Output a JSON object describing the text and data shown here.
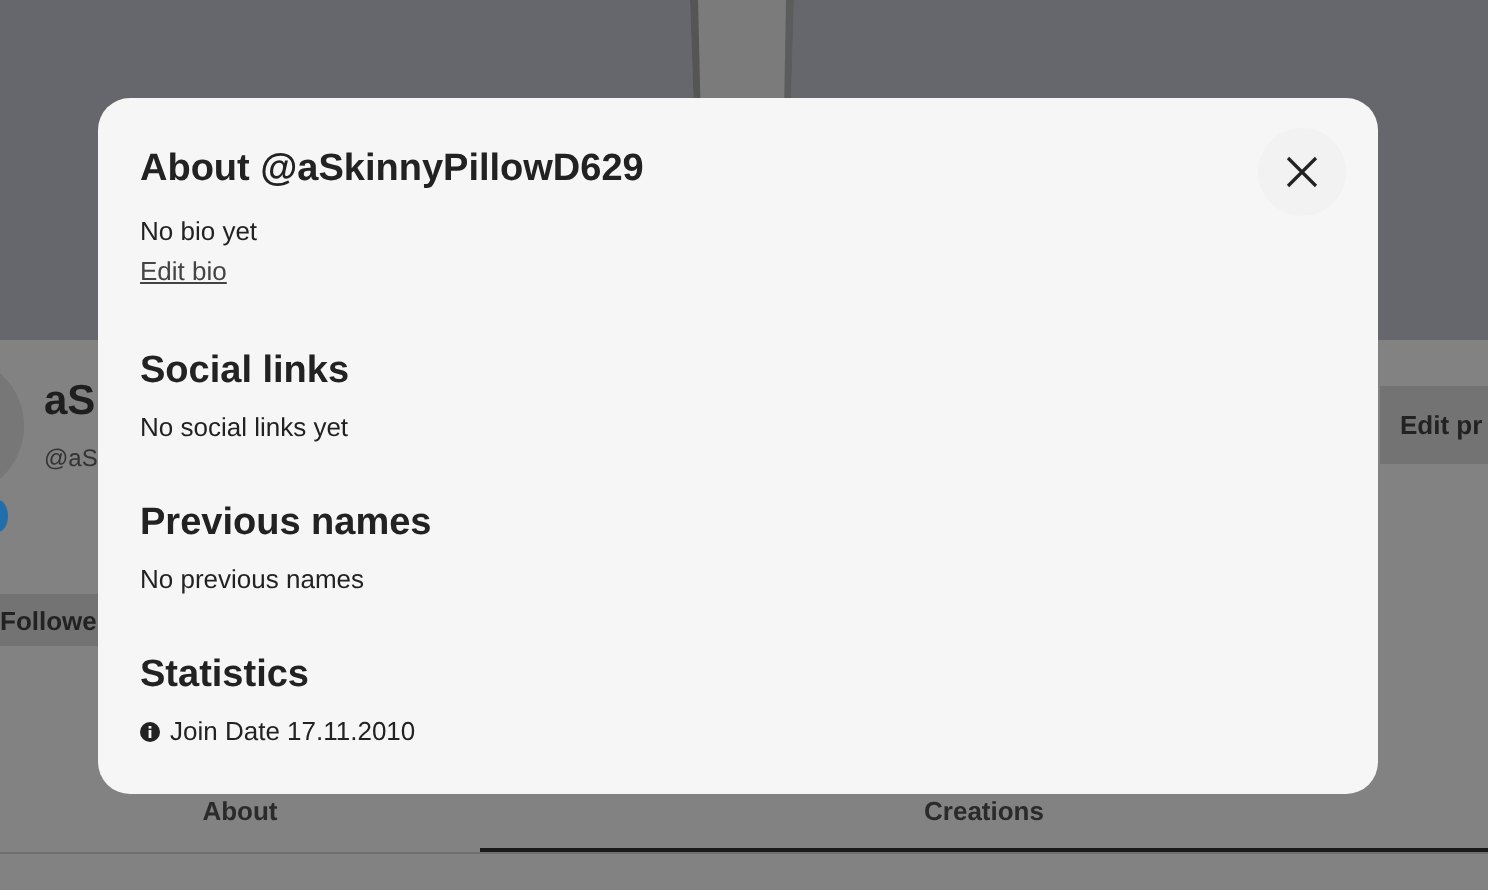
{
  "profile": {
    "name": "aS",
    "handle": "@aS",
    "followers_button": "Followe",
    "edit_button": "Edit pr",
    "verified": true
  },
  "tabs": [
    {
      "label": "About",
      "selected": false
    },
    {
      "label": "Creations",
      "selected": true
    }
  ],
  "dialog": {
    "title": "About @aSkinnyPillowD629",
    "bio": "No bio yet",
    "edit_link": "Edit bio",
    "sections": [
      {
        "heading": "Social links",
        "text": "No social links yet"
      },
      {
        "heading": "Previous names",
        "text": "No previous names"
      },
      {
        "heading": "Statistics",
        "text": "Join Date 17.11.2010",
        "kind": "info"
      }
    ]
  }
}
